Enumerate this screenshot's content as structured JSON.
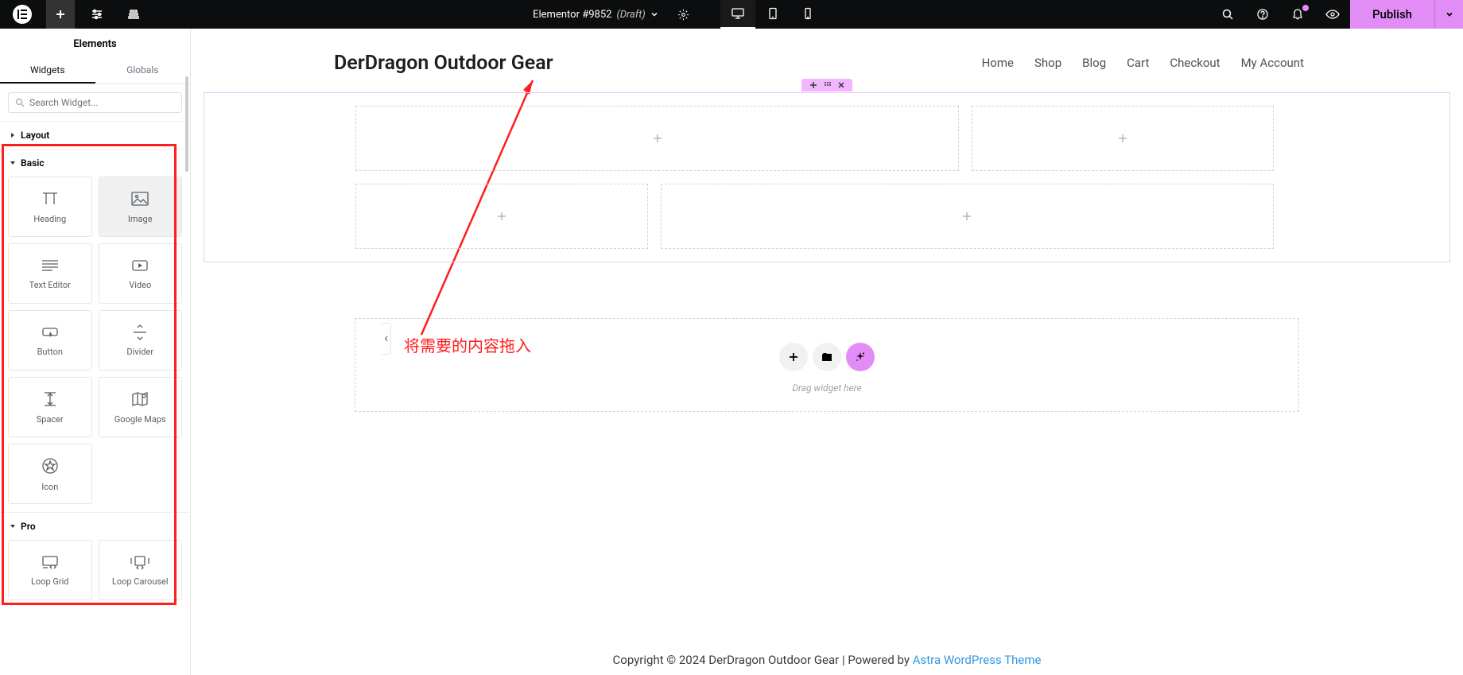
{
  "topbar": {
    "page_name": "Elementor #9852",
    "draft": "(Draft)",
    "publish": "Publish"
  },
  "panel": {
    "title": "Elements",
    "tabs": {
      "widgets": "Widgets",
      "globals": "Globals"
    },
    "search_placeholder": "Search Widget...",
    "categories": {
      "layout": "Layout",
      "basic": "Basic",
      "pro": "Pro"
    },
    "widgets": {
      "heading": "Heading",
      "image": "Image",
      "text_editor": "Text Editor",
      "video": "Video",
      "button": "Button",
      "divider": "Divider",
      "spacer": "Spacer",
      "google_maps": "Google Maps",
      "icon": "Icon",
      "loop_grid": "Loop Grid",
      "loop_carousel": "Loop Carousel"
    }
  },
  "annotation": {
    "text": "将需要的内容拖入"
  },
  "site": {
    "title": "DerDragon Outdoor Gear",
    "nav": {
      "home": "Home",
      "shop": "Shop",
      "blog": "Blog",
      "cart": "Cart",
      "checkout": "Checkout",
      "account": "My Account"
    }
  },
  "drop": {
    "text": "Drag widget here"
  },
  "footer": {
    "text_a": "Copyright © 2024 DerDragon Outdoor Gear | Powered by ",
    "link": "Astra WordPress Theme"
  }
}
